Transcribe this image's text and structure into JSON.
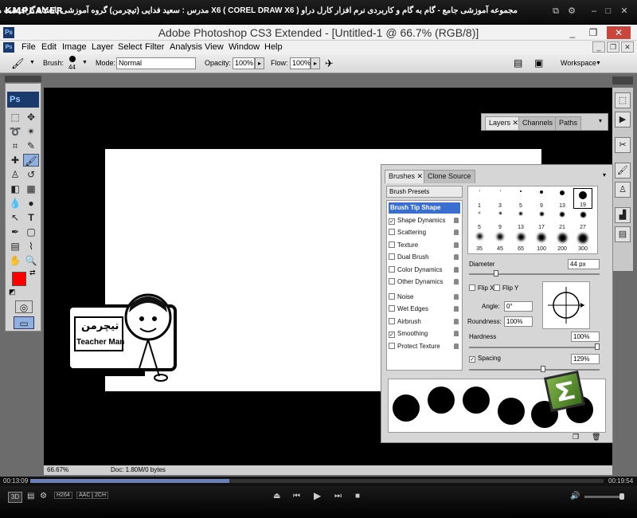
{
  "player": {
    "logo": "KMPLAYER",
    "title": "مجموعه آموزشی جامع - گام به گام و کاربردی نرم افزار کارل دراو  X6  ( COREL DRAW X6 ) مدرس : سعید فدایی (تیچرمن) گروه آموزشی پادشاه گرافیست ها",
    "time_current": "00:13:09",
    "time_total": "00:19:54",
    "badges": [
      "3D",
      "H264",
      "AAC",
      "2CH"
    ]
  },
  "window": {
    "title": "Adobe Photoshop CS3 Extended - [Untitled-1 @ 66.7% (RGB/8)]",
    "app_icon": "Ps"
  },
  "menu": [
    "File",
    "Edit",
    "Image",
    "Layer",
    "Select",
    "Filter",
    "Analysis",
    "View",
    "Window",
    "Help"
  ],
  "options": {
    "brush_label": "Brush:",
    "brush_size": "44",
    "mode_label": "Mode:",
    "mode_value": "Normal",
    "opacity_label": "Opacity:",
    "opacity_value": "100%",
    "flow_label": "Flow:",
    "flow_value": "100%",
    "workspace": "Workspace"
  },
  "tools": {
    "ps_logo": "Ps"
  },
  "layers_panel": {
    "tabs": [
      "Layers",
      "Channels",
      "Paths"
    ]
  },
  "brushes_panel": {
    "tabs": [
      "Brushes",
      "Clone Source"
    ],
    "presets": "Brush Presets",
    "options": [
      {
        "label": "Brush Tip Shape",
        "checked": null,
        "selected": true
      },
      {
        "label": "Shape Dynamics",
        "checked": true
      },
      {
        "label": "Scattering",
        "checked": false
      },
      {
        "label": "Texture",
        "checked": false
      },
      {
        "label": "Dual Brush",
        "checked": false
      },
      {
        "label": "Color Dynamics",
        "checked": false
      },
      {
        "label": "Other Dynamics",
        "checked": false
      },
      {
        "label": "Noise",
        "checked": false
      },
      {
        "label": "Wet Edges",
        "checked": false
      },
      {
        "label": "Airbrush",
        "checked": false
      },
      {
        "label": "Smoothing",
        "checked": true
      },
      {
        "label": "Protect Texture",
        "checked": false
      }
    ],
    "tips": [
      "1",
      "3",
      "5",
      "9",
      "13",
      "19",
      "5",
      "9",
      "13",
      "17",
      "21",
      "27",
      "35",
      "45",
      "65",
      "100",
      "200",
      "300"
    ],
    "diameter_label": "Diameter",
    "diameter_value": "44 px",
    "flipx": "Flip X",
    "flipy": "Flip Y",
    "angle_label": "Angle:",
    "angle_value": "0°",
    "roundness_label": "Roundness:",
    "roundness_value": "100%",
    "hardness_label": "Hardness",
    "hardness_value": "100%",
    "spacing_label": "Spacing",
    "spacing_value": "129%"
  },
  "status": {
    "zoom": "66.67%",
    "doc": "Doc: 1.80M/0 bytes"
  },
  "watermark": {
    "brand": "Teacher Man",
    "script": "تیچرمن"
  }
}
